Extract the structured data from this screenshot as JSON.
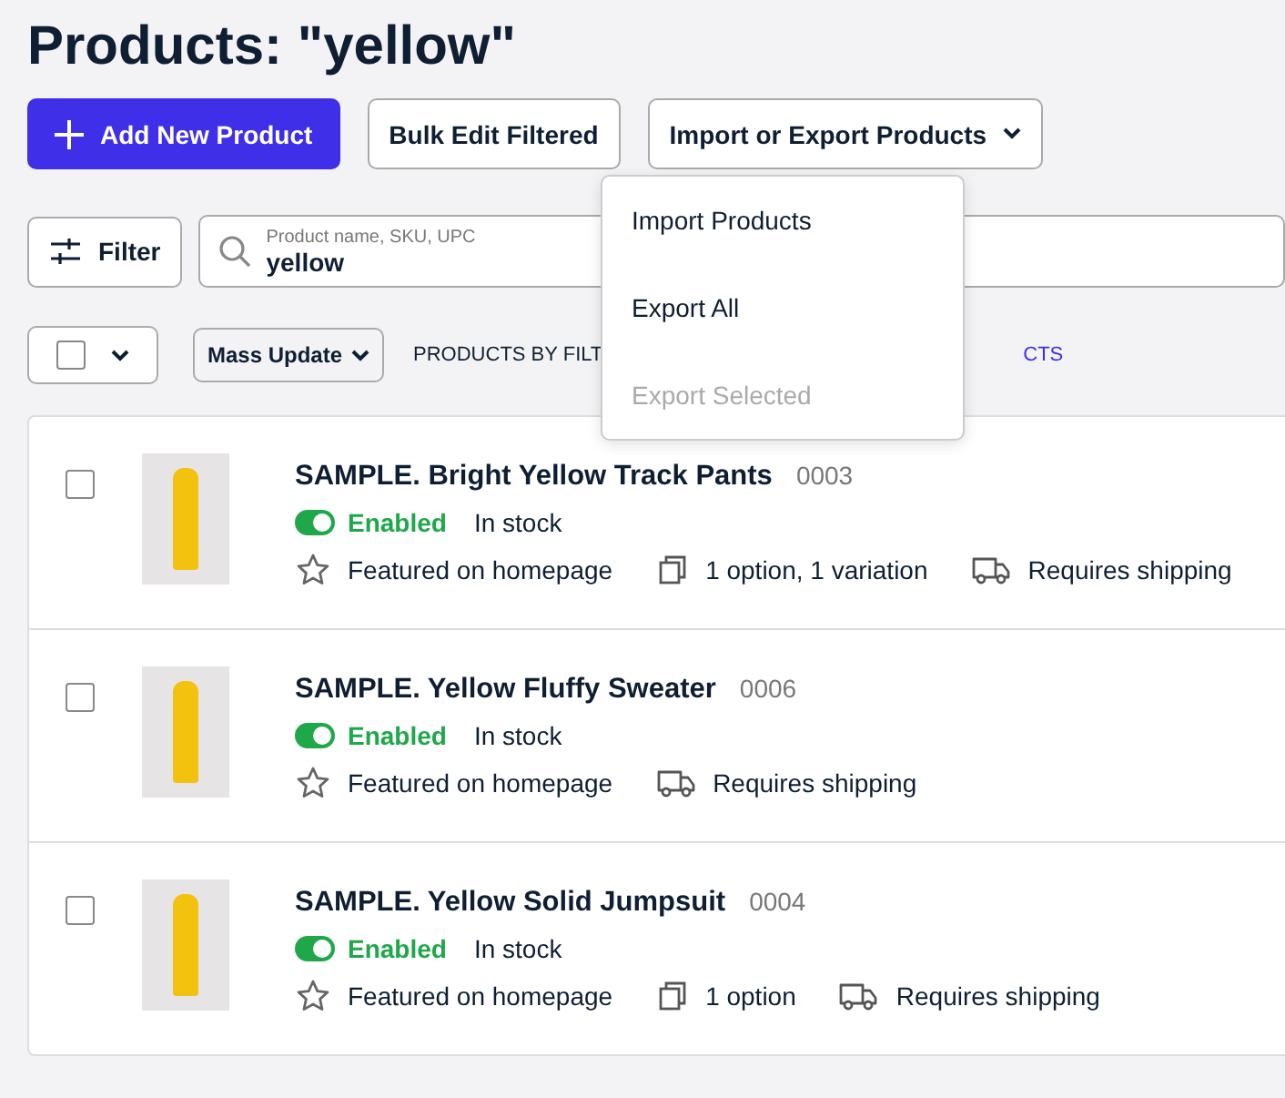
{
  "title": "Products: \"yellow\"",
  "actions": [
    {
      "kind": "primary",
      "label": "Add New Product"
    },
    {
      "kind": "plain",
      "label": "Bulk Edit Filtered"
    },
    {
      "kind": "dropdown",
      "label": "Import or Export Products"
    }
  ],
  "menu": {
    "items": [
      {
        "label": "Import Products",
        "disabled": false
      },
      {
        "label": "Export All",
        "disabled": false
      },
      {
        "label": "Export Selected",
        "disabled": true
      }
    ]
  },
  "filter": {
    "label": "Filter"
  },
  "search": {
    "placeholder": "Product name, SKU, UPC",
    "value": "yellow"
  },
  "bulk": {
    "checked": false,
    "mass_update": "Mass Update",
    "products_by_filter": "PRODUCTS BY FILT",
    "link_tail": "CTS"
  },
  "products": [
    {
      "name": "SAMPLE. Bright Yellow Track Pants",
      "sku": "0003",
      "enabled": true,
      "status": "Enabled",
      "stock": "In stock",
      "checked": false,
      "features": [
        {
          "kind": "star",
          "label": "Featured on homepage"
        },
        {
          "kind": "options",
          "label": "1 option, 1 variation"
        },
        {
          "kind": "shipping",
          "label": "Requires shipping"
        }
      ]
    },
    {
      "name": "SAMPLE. Yellow Fluffy Sweater",
      "sku": "0006",
      "enabled": true,
      "status": "Enabled",
      "stock": "In stock",
      "checked": false,
      "features": [
        {
          "kind": "star",
          "label": "Featured on homepage"
        },
        {
          "kind": "shipping",
          "label": "Requires shipping"
        }
      ]
    },
    {
      "name": "SAMPLE. Yellow Solid Jumpsuit",
      "sku": "0004",
      "enabled": true,
      "status": "Enabled",
      "stock": "In stock",
      "checked": false,
      "features": [
        {
          "kind": "star",
          "label": "Featured on homepage"
        },
        {
          "kind": "options",
          "label": "1 option"
        },
        {
          "kind": "shipping",
          "label": "Requires shipping"
        }
      ]
    }
  ]
}
